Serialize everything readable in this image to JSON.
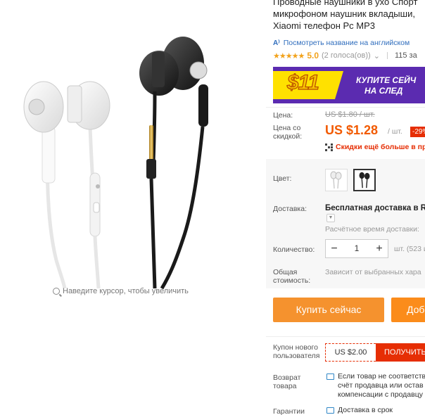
{
  "product": {
    "title_lines": [
      "Проводные наушники в ухо Спорт",
      "микрофоном наушник вкладыши,",
      "Xiaomi телефон Pc MP3"
    ],
    "translate_link": "Посмотреть название на английском",
    "rating": {
      "stars": "★★★★★",
      "value": "5.0",
      "count": "(2 голоса(ов))",
      "orders": "115 за"
    },
    "zoom_hint": "Наведите курсор, чтобы увеличить"
  },
  "banner": {
    "amount": "$11",
    "line1": "КУПИТЕ СЕЙЧ",
    "line2": "НА СЛЕД"
  },
  "price": {
    "label": "Цена:",
    "old": "US $1.80 / шт.",
    "discount_label_line1": "Цена со",
    "discount_label_line2": "скидкой:",
    "new": "US $1.28",
    "unit": "/ шт.",
    "percent": "-29%",
    "bulk": "Скидки ещё больше в пр"
  },
  "options": {
    "color_label": "Цвет:",
    "colors": [
      "white",
      "black"
    ],
    "selected_color": "black",
    "delivery_label": "Доставка:",
    "delivery_value": "Бесплатная доставка в Rus",
    "delivery_time": "Расчётное время доставки:",
    "quantity_label": "Количество:",
    "quantity": "1",
    "available": "шт. (523 и",
    "total_label_line1": "Общая",
    "total_label_line2": "стоимость:",
    "total_value": "Зависит от выбранных хара"
  },
  "actions": {
    "buy": "Купить сейчас",
    "cart": "Доб"
  },
  "coupon": {
    "label_line1": "Купон нового",
    "label_line2": "пользователя",
    "value": "US $2.00",
    "button": "ПОЛУЧИТЬ"
  },
  "guarantees": {
    "return_label_line1": "Возврат",
    "return_label_line2": "товара",
    "return_text": [
      "Если товар не соответств",
      "счёт продавца или остав",
      "компенсации с продавцу"
    ],
    "warranty_label": "Гарантии",
    "warranty_text": "Доставка в срок"
  },
  "colors": {
    "accent": "#f25a00",
    "buy_button": "#f5922e",
    "cart_button": "#fb8c1b",
    "discount_red": "#e62e04",
    "link": "#2f6dbd",
    "banner_purple": "#5b2bb0"
  }
}
